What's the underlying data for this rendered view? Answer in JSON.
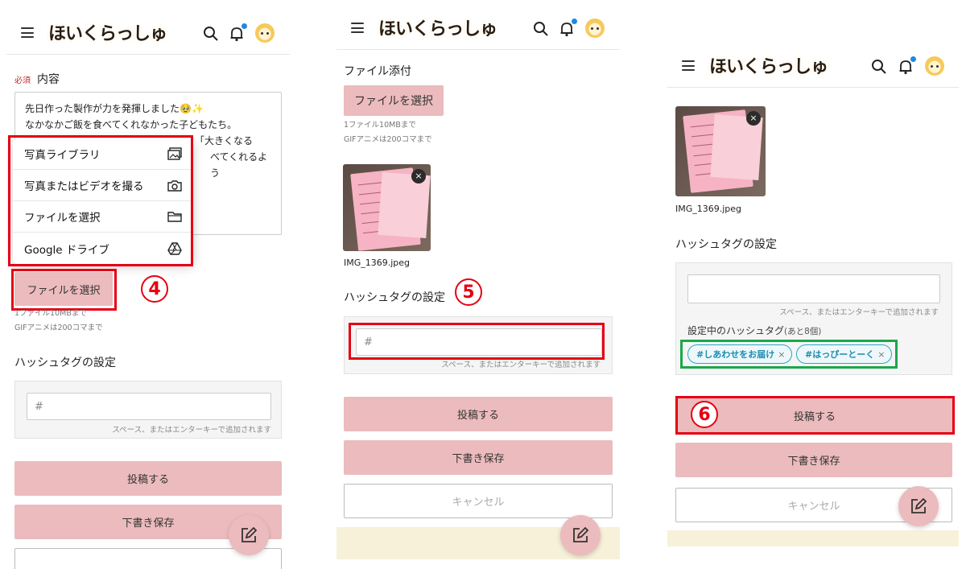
{
  "header": {
    "logo_text": "ほいくらっしゅ",
    "notification_dot_color": "#1e88e5"
  },
  "panel1": {
    "required_badge": "必須",
    "content_label": "内容",
    "content_lines": [
      "先日作った製作が力を発揮しました🥹✨",
      "なかなかご飯を食べてくれなかった子どもたち。",
      "、「大きくなる",
      "べてくれるよう"
    ],
    "menu": [
      {
        "label": "写真ライブラリ",
        "icon": "photo-library-icon"
      },
      {
        "label": "写真またはビデオを撮る",
        "icon": "camera-icon"
      },
      {
        "label": "ファイルを選択",
        "icon": "folder-icon"
      },
      {
        "label": "Google ドライブ",
        "icon": "google-drive-icon"
      }
    ],
    "file_button": "ファイルを選択",
    "step_number": "4",
    "file_note_1": "1ファイル10MBまで",
    "file_note_2": "GIFアニメは200コマまで",
    "hashtag_label": "ハッシュタグの設定",
    "hashtag_placeholder": "#",
    "hashtag_note": "スペース、またはエンターキーで追加されます",
    "post_button": "投稿する",
    "draft_button": "下書き保存"
  },
  "panel2": {
    "attach_label": "ファイル添付",
    "file_button": "ファイルを選択",
    "file_note_1": "1ファイル10MBまで",
    "file_note_2": "GIFアニメは200コマまで",
    "file_name": "IMG_1369.jpeg",
    "hashtag_label": "ハッシュタグの設定",
    "step_number": "5",
    "hashtag_placeholder": "#",
    "hashtag_note": "スペース、またはエンターキーで追加されます",
    "post_button": "投稿する",
    "draft_button": "下書き保存",
    "cancel_button": "キャンセル"
  },
  "panel3": {
    "file_name": "IMG_1369.jpeg",
    "hashtag_label": "ハッシュタグの設定",
    "hashtag_note": "スペース、またはエンターキーで追加されます",
    "current_tags_label": "設定中のハッシュタグ",
    "remaining": "(あと8個)",
    "tags": [
      "#しあわせをお届け",
      "#はっぴーとーく"
    ],
    "step_number": "6",
    "post_button": "投稿する",
    "draft_button": "下書き保存",
    "cancel_button": "キャンセル"
  },
  "colors": {
    "accent_pink": "#ecbbbd",
    "highlight_red": "#e50012",
    "highlight_green": "#1aa84b",
    "tag_blue": "#2aa6c8"
  }
}
